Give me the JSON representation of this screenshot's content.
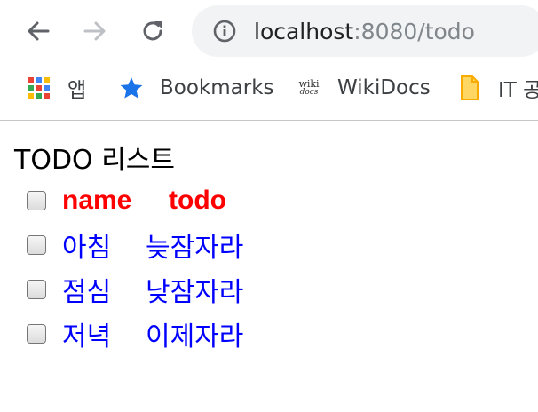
{
  "browser": {
    "url_host": "localhost",
    "url_rest": ":8080/todo"
  },
  "bookmarks": [
    {
      "label": "앱",
      "icon": "apps-grid-icon"
    },
    {
      "label": "Bookmarks",
      "icon": "star-icon"
    },
    {
      "label": "WikiDocs",
      "icon": "wikidocs-icon",
      "icon_text": [
        "wiki",
        "docs"
      ]
    },
    {
      "label": "IT 공",
      "icon": "folder-icon"
    }
  ],
  "page": {
    "title": "TODO 리스트",
    "header": {
      "name": "name",
      "todo": "todo"
    },
    "items": [
      {
        "name": "아침",
        "todo": "늦잠자라"
      },
      {
        "name": "점심",
        "todo": "낮잠자라"
      },
      {
        "name": "저녁",
        "todo": "이제자라"
      }
    ]
  },
  "colors": {
    "header_text": "#ff0000",
    "item_text": "#0000ff",
    "star": "#1a73e8",
    "folder": "#fbc02d"
  }
}
